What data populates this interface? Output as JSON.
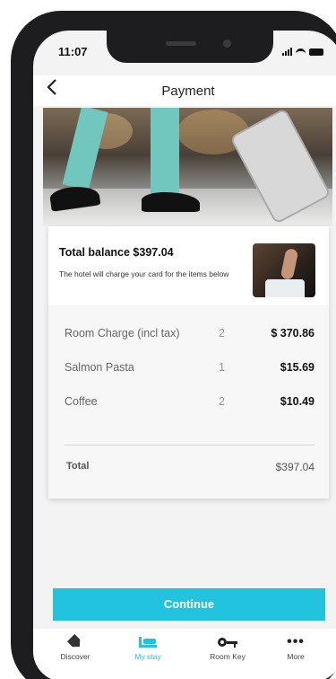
{
  "status_bar": {
    "time": "11:07"
  },
  "header": {
    "title": "Payment",
    "back_icon": "chevron-left-icon"
  },
  "balance": {
    "title": "Total balance $397.04",
    "description": "The hotel will charge your card for the items below"
  },
  "items": [
    {
      "name": "Room Charge (incl tax)",
      "qty": "2",
      "price": "$ 370.86"
    },
    {
      "name": "Salmon Pasta",
      "qty": "1",
      "price": "$15.69"
    },
    {
      "name": "Coffee",
      "qty": "2",
      "price": "$10.49"
    }
  ],
  "total": {
    "label": "Total",
    "value": "$397.04"
  },
  "continue_label": "Continue",
  "tabs": [
    {
      "label": "Discover",
      "icon": "tag-icon",
      "active": false
    },
    {
      "label": "My stay",
      "icon": "bed-icon",
      "active": true
    },
    {
      "label": "Room Key",
      "icon": "key-icon",
      "active": false
    },
    {
      "label": "More",
      "icon": "more-icon",
      "active": false
    }
  ],
  "colors": {
    "accent": "#21c3df"
  }
}
